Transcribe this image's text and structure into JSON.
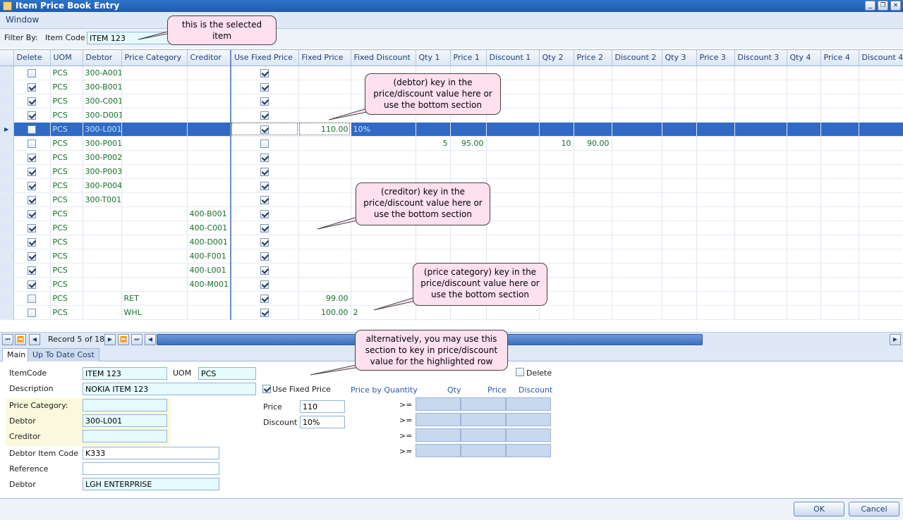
{
  "window": {
    "title": "Item Price Book Entry"
  },
  "menu": {
    "window": "Window"
  },
  "filter": {
    "label": "Filter By:",
    "field_label": "Item Code",
    "value": "ITEM 123"
  },
  "grid": {
    "columns": [
      "Delete",
      "UOM",
      "Debtor",
      "Price Category",
      "Creditor",
      "Use Fixed Price",
      "Fixed Price",
      "Fixed Discount",
      "Qty 1",
      "Price 1",
      "Discount 1",
      "Qty 2",
      "Price 2",
      "Discount 2",
      "Qty 3",
      "Price 3",
      "Discount 3",
      "Qty 4",
      "Price 4",
      "Discount 4"
    ],
    "rows": [
      {
        "delete": false,
        "uom": "PCS",
        "debtor": "300-A001",
        "price_category": "",
        "creditor": "",
        "use_fixed": true,
        "fixed_price": "",
        "fixed_discount": "",
        "qty1": "",
        "price1": "",
        "qty2": "",
        "price2": ""
      },
      {
        "delete": true,
        "uom": "PCS",
        "debtor": "300-B001",
        "price_category": "",
        "creditor": "",
        "use_fixed": true,
        "fixed_price": "",
        "fixed_discount": "",
        "qty1": "",
        "price1": "",
        "qty2": "",
        "price2": ""
      },
      {
        "delete": true,
        "uom": "PCS",
        "debtor": "300-C001",
        "price_category": "",
        "creditor": "",
        "use_fixed": true,
        "fixed_price": "",
        "fixed_discount": "",
        "qty1": "",
        "price1": "",
        "qty2": "",
        "price2": ""
      },
      {
        "delete": true,
        "uom": "PCS",
        "debtor": "300-D001",
        "price_category": "",
        "creditor": "",
        "use_fixed": true,
        "fixed_price": "",
        "fixed_discount": "",
        "qty1": "",
        "price1": "",
        "qty2": "",
        "price2": ""
      },
      {
        "delete": false,
        "uom": "PCS",
        "debtor": "300-L001",
        "price_category": "",
        "creditor": "",
        "use_fixed": true,
        "fixed_price": "110.00",
        "fixed_discount": "10%",
        "qty1": "",
        "price1": "",
        "qty2": "",
        "price2": "",
        "selected": true
      },
      {
        "delete": false,
        "uom": "PCS",
        "debtor": "300-P001",
        "price_category": "",
        "creditor": "",
        "use_fixed": false,
        "fixed_price": "",
        "fixed_discount": "",
        "qty1": "5",
        "price1": "95.00",
        "qty2": "10",
        "price2": "90.00"
      },
      {
        "delete": true,
        "uom": "PCS",
        "debtor": "300-P002",
        "price_category": "",
        "creditor": "",
        "use_fixed": true,
        "fixed_price": "",
        "fixed_discount": "",
        "qty1": "",
        "price1": "",
        "qty2": "",
        "price2": ""
      },
      {
        "delete": true,
        "uom": "PCS",
        "debtor": "300-P003",
        "price_category": "",
        "creditor": "",
        "use_fixed": true,
        "fixed_price": "",
        "fixed_discount": "",
        "qty1": "",
        "price1": "",
        "qty2": "",
        "price2": ""
      },
      {
        "delete": true,
        "uom": "PCS",
        "debtor": "300-P004",
        "price_category": "",
        "creditor": "",
        "use_fixed": true,
        "fixed_price": "",
        "fixed_discount": "",
        "qty1": "",
        "price1": "",
        "qty2": "",
        "price2": ""
      },
      {
        "delete": true,
        "uom": "PCS",
        "debtor": "300-T001",
        "price_category": "",
        "creditor": "",
        "use_fixed": true,
        "fixed_price": "",
        "fixed_discount": "",
        "qty1": "",
        "price1": "",
        "qty2": "",
        "price2": ""
      },
      {
        "delete": true,
        "uom": "PCS",
        "debtor": "",
        "price_category": "",
        "creditor": "400-B001",
        "use_fixed": true,
        "fixed_price": "",
        "fixed_discount": "",
        "qty1": "",
        "price1": "",
        "qty2": "",
        "price2": ""
      },
      {
        "delete": true,
        "uom": "PCS",
        "debtor": "",
        "price_category": "",
        "creditor": "400-C001",
        "use_fixed": true,
        "fixed_price": "",
        "fixed_discount": "",
        "qty1": "",
        "price1": "",
        "qty2": "",
        "price2": ""
      },
      {
        "delete": true,
        "uom": "PCS",
        "debtor": "",
        "price_category": "",
        "creditor": "400-D001",
        "use_fixed": true,
        "fixed_price": "",
        "fixed_discount": "",
        "qty1": "",
        "price1": "",
        "qty2": "",
        "price2": ""
      },
      {
        "delete": true,
        "uom": "PCS",
        "debtor": "",
        "price_category": "",
        "creditor": "400-F001",
        "use_fixed": true,
        "fixed_price": "",
        "fixed_discount": "",
        "qty1": "",
        "price1": "",
        "qty2": "",
        "price2": ""
      },
      {
        "delete": true,
        "uom": "PCS",
        "debtor": "",
        "price_category": "",
        "creditor": "400-L001",
        "use_fixed": true,
        "fixed_price": "",
        "fixed_discount": "",
        "qty1": "",
        "price1": "",
        "qty2": "",
        "price2": ""
      },
      {
        "delete": true,
        "uom": "PCS",
        "debtor": "",
        "price_category": "",
        "creditor": "400-M001",
        "use_fixed": true,
        "fixed_price": "",
        "fixed_discount": "",
        "qty1": "",
        "price1": "",
        "qty2": "",
        "price2": ""
      },
      {
        "delete": false,
        "uom": "PCS",
        "debtor": "",
        "price_category": "RET",
        "creditor": "",
        "use_fixed": true,
        "fixed_price": "99.00",
        "fixed_discount": "",
        "qty1": "",
        "price1": "",
        "qty2": "",
        "price2": ""
      },
      {
        "delete": false,
        "uom": "PCS",
        "debtor": "",
        "price_category": "WHL",
        "creditor": "",
        "use_fixed": true,
        "fixed_price": "100.00",
        "fixed_discount": "2",
        "qty1": "",
        "price1": "",
        "qty2": "",
        "price2": ""
      }
    ]
  },
  "nav": {
    "record_text": "Record 5 of 18"
  },
  "tabs": {
    "main": "Main",
    "cost": "Up To Date Cost"
  },
  "form": {
    "item_code_label": "ItemCode",
    "item_code": "ITEM 123",
    "uom_label": "UOM",
    "uom": "PCS",
    "description_label": "Description",
    "description": "NOKIA ITEM 123",
    "price_category_label": "Price Category:",
    "price_category": "",
    "debtor_label": "Debtor",
    "debtor": "300-L001",
    "creditor_label": "Creditor",
    "creditor": "",
    "debtor_item_code_label": "Debtor Item Code",
    "debtor_item_code": "K333",
    "reference_label": "Reference",
    "reference": "",
    "debtor_name_label": "Debtor",
    "debtor_name": "LGH ENTERPRISE",
    "use_fixed_label": "Use Fixed Price",
    "price_label": "Price",
    "price": "110",
    "discount_label": "Discount",
    "discount": "10%",
    "delete_label": "Delete",
    "pbq_label": "Price by Quantity",
    "qty_label": "Qty",
    "qprice_label": "Price",
    "qdisc_label": "Discount",
    "ge": ">="
  },
  "buttons": {
    "ok": "OK",
    "cancel": "Cancel"
  },
  "callouts": {
    "selected": "this is the selected item",
    "debtor": "(debtor) key in the price/discount value here or use the bottom section",
    "creditor": "(creditor) key in the price/discount value here or use the bottom section",
    "price_category": "(price category) key in the price/discount value here or use the bottom section",
    "alternative": "alternatively, you may use this section to key in price/discount value for the highlighted row"
  },
  "colors": {
    "selection": "#316ac5",
    "titlebar": "#2e73c8",
    "callout": "#ffe0ef",
    "field": "#e5fbff"
  }
}
